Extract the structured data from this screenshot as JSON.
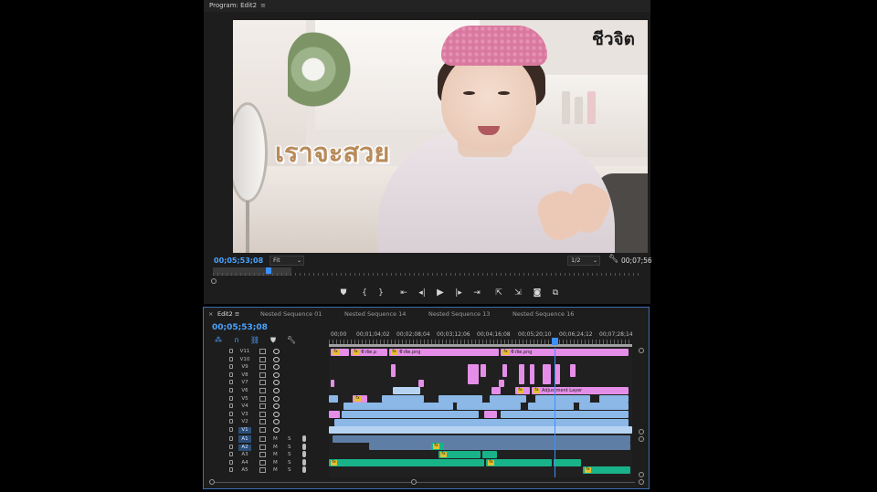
{
  "program": {
    "title": "Program: Edit2",
    "menu_icon": "≡",
    "logo_text": "ชีวจิต",
    "caption": "เราจะสวย",
    "current_tc": "00;05;53;08",
    "fit": "Fit",
    "resolution": "1/2",
    "duration_tc": "00;07;56"
  },
  "transport": [
    "marker-icon",
    "mark-in-icon",
    "mark-out-icon",
    "go-to-in-icon",
    "step-back-icon",
    "play-icon",
    "step-forward-icon",
    "go-to-out-icon",
    "lift-icon",
    "extract-icon",
    "export-frame-icon",
    "comparison-view-icon"
  ],
  "timeline": {
    "close": "×",
    "tabs": [
      "Edit2",
      "Nested Sequence 01",
      "Nested Sequence 14",
      "Nested Sequence 13",
      "Nested Sequence 16"
    ],
    "active_tab_menu": "≡",
    "current_tc": "00;05;53;08",
    "ruler": [
      "00;00",
      "00;01;04;02",
      "00;02;08;04",
      "00;03;12;06",
      "00;04;16;08",
      "00;05;20;10",
      "00;06;24;12",
      "00;07;28;14"
    ],
    "video_tracks": [
      "V11",
      "V10",
      "V9",
      "V8",
      "V7",
      "V6",
      "V5",
      "V4",
      "V3",
      "V2",
      "V1"
    ],
    "audio_tracks": [
      "A1",
      "A2",
      "A3",
      "A4",
      "A5"
    ],
    "mute": "M",
    "solo": "S",
    "clip_labels": {
      "v11_a": "ชีวจิต.p",
      "v11_b": "ชีวจิต.png",
      "v11_c": "ชีวจิต.png",
      "v6": "Adjustment Layer",
      "fx": "fx"
    },
    "colors": {
      "playhead": "#3d8fff",
      "title_clip": "#e58ee8",
      "video_clip": "#8cb8e8",
      "audio_clip": "#19b389"
    }
  }
}
